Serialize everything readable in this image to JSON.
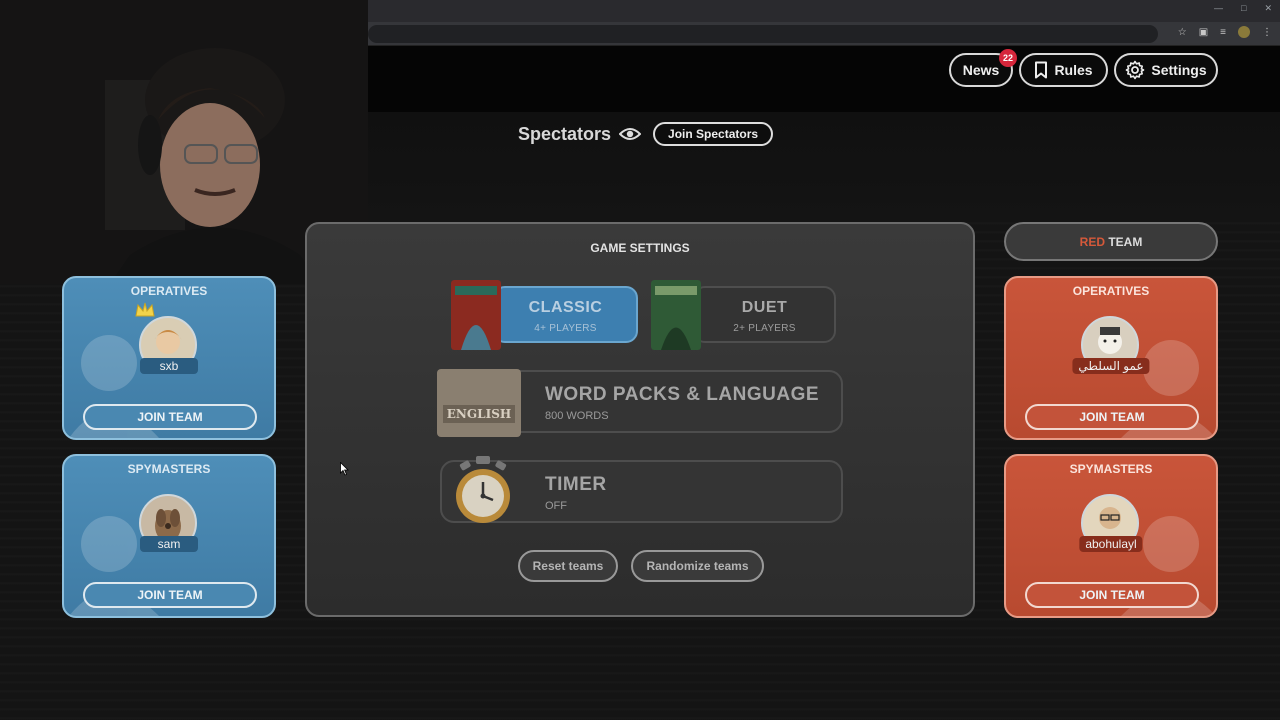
{
  "header": {
    "news_label": "News",
    "news_count": "22",
    "rules_label": "Rules",
    "settings_label": "Settings"
  },
  "spectators": {
    "title": "Spectators",
    "join_label": "Join Spectators"
  },
  "red_team": {
    "word": "RED",
    "label": "TEAM",
    "operatives": {
      "title": "OPERATIVES",
      "player": "عمو السلطي",
      "join_label": "JOIN TEAM"
    },
    "spymasters": {
      "title": "SPYMASTERS",
      "player": "abohulayl",
      "join_label": "JOIN TEAM"
    }
  },
  "blue_team": {
    "operatives": {
      "title": "OPERATIVES",
      "player": "sxb",
      "join_label": "JOIN TEAM"
    },
    "spymasters": {
      "title": "SPYMASTERS",
      "player": "sam",
      "join_label": "JOIN TEAM"
    }
  },
  "game_settings": {
    "title": "GAME SETTINGS",
    "modes": [
      {
        "label": "CLASSIC",
        "sub": "4+ PLAYERS",
        "selected": true
      },
      {
        "label": "DUET",
        "sub": "2+ PLAYERS",
        "selected": false
      }
    ],
    "word_packs": {
      "title": "WORD PACKS & LANGUAGE",
      "sub": "800 WORDS",
      "language_tag": "ENGLISH"
    },
    "timer": {
      "title": "TIMER",
      "sub": "OFF"
    },
    "reset_label": "Reset teams",
    "randomize_label": "Randomize teams"
  },
  "colors": {
    "blue_panel": "#4e8eb8",
    "red_panel": "#c9553a",
    "news_badge": "#d6263b",
    "selected_mode": "#3d7fb0"
  }
}
